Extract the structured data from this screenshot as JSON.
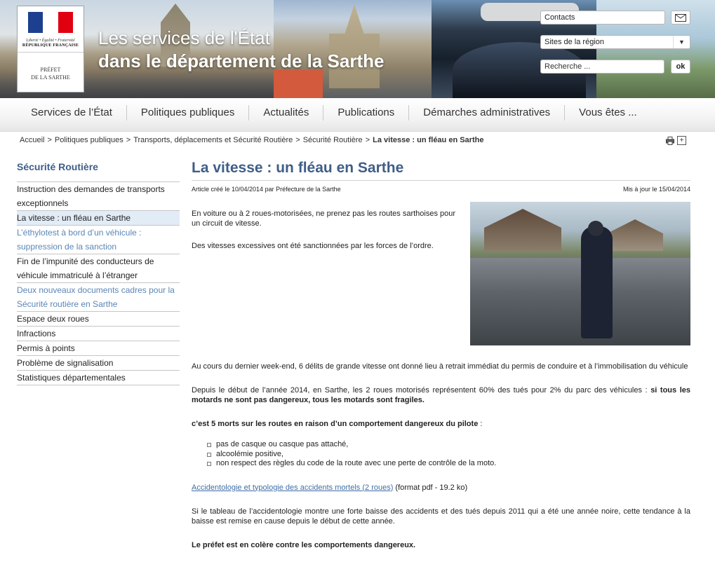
{
  "header": {
    "logo": {
      "motto": "Liberté • Égalité • Fraternité",
      "republic": "RÉPUBLIQUE FRANÇAISE",
      "prefet_line1": "PRÉFET",
      "prefet_line2": "DE LA SARTHE"
    },
    "title_line1": "Les services de l'État",
    "title_line2": "dans le département de la Sarthe",
    "contacts_label": "Contacts",
    "sites_select": "Sites de la région",
    "search_placeholder": "Recherche ...",
    "search_button": "ok",
    "icons": [
      "mail-icon",
      "chevron-down-icon"
    ]
  },
  "nav": {
    "items": [
      {
        "label": "Services de l’État"
      },
      {
        "label": "Politiques publiques"
      },
      {
        "label": "Actualités"
      },
      {
        "label": "Publications"
      },
      {
        "label": "Démarches administratives"
      },
      {
        "label": "Vous êtes ..."
      }
    ]
  },
  "breadcrumb": {
    "items": [
      "Accueil",
      "Politiques publiques",
      "Transports, déplacements et Sécurité Routière",
      "Sécurité Routière"
    ],
    "current": "La vitesse : un fléau en Sarthe",
    "separator": ">",
    "tools": [
      "print-icon",
      "plus-icon"
    ]
  },
  "sidebar": {
    "title": "Sécurité Routière",
    "items": [
      {
        "label": "Instruction des demandes de transports exceptionnels"
      },
      {
        "label": "La vitesse : un fléau en Sarthe"
      },
      {
        "label": "L’éthylotest à bord d’un véhicule : suppression de la sanction"
      },
      {
        "label": "Fin de l’impunité des conducteurs de véhicule immatriculé à l’étranger"
      },
      {
        "label": "Deux nouveaux documents cadres pour la Sécurité routière en Sarthe"
      },
      {
        "label": "Espace deux roues"
      },
      {
        "label": "Infractions"
      },
      {
        "label": "Permis à points"
      },
      {
        "label": "Problème de signalisation"
      },
      {
        "label": "Statistiques départementales"
      }
    ]
  },
  "article": {
    "title": "La vitesse : un fléau en Sarthe",
    "created": "Article créé le 10/04/2014 par Préfecture de la Sarthe",
    "updated": "Mis à jour le 15/04/2014",
    "intro_p1": "En voiture ou à 2 roues-motorisées, ne prenez pas les routes sarthoises pour un circuit de vitesse.",
    "intro_p2": "Des vitesses excessives ont été sanctionnées par les forces de l’ordre.",
    "p1": "Au cours du dernier week-end, 6 délits de grande vitesse ont donné lieu à retrait immédiat du permis de conduire et à l’immobilisation du véhicule",
    "p2_start": "Depuis le début de l’année 2014, en Sarthe, les 2 roues motorisés représentent 60% des tués pour 2% du parc des véhicules : ",
    "p2_bold": "si tous les motards ne sont pas dangereux, tous les motards sont fragiles.",
    "p3_bold": "c’est 5 morts sur les routes en raison d’un comportement dangereux du pilote",
    "p3_end": " :",
    "list": [
      "pas de casque ou casque pas attaché,",
      "alcoolémie positive,",
      "non respect des règles du code de la route avec une perte de contrôle de la moto."
    ],
    "doc_link": "Accidentologie et typologie des accidents mortels (2 roues)",
    "doc_info": " (format pdf - 19.2 ko)",
    "p4": "Si le tableau de l’accidentologie montre une forte baisse des accidents et des tués depuis 2011 qui a été une année noire, cette tendance à la baisse est remise en cause depuis le début de cette année.",
    "p5_bold": "Le préfet est en colère contre les comportements dangereux."
  },
  "colors": {
    "accent": "#3f5e87",
    "link": "#5b86b6",
    "active_bg": "#e2ecf6"
  }
}
